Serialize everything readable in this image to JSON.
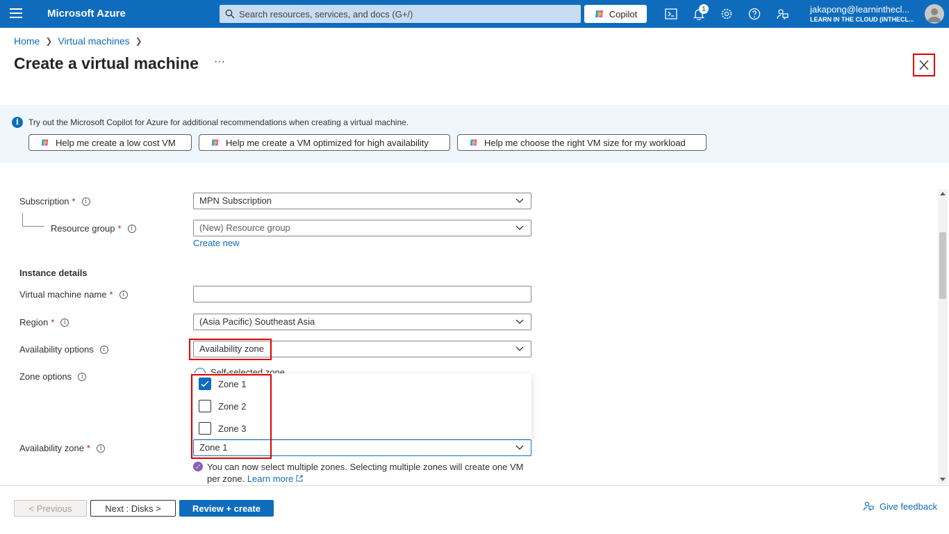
{
  "topbar": {
    "brand": "Microsoft Azure",
    "search_placeholder": "Search resources, services, and docs (G+/)",
    "copilot_label": "Copilot",
    "notification_count": "1",
    "account_email": "jakapong@learninthecl...",
    "account_tenant": "LEARN IN THE CLOUD (INTHECL..."
  },
  "breadcrumb": {
    "home": "Home",
    "virtual_machines": "Virtual machines"
  },
  "page": {
    "title": "Create a virtual machine",
    "more": "···"
  },
  "banner": {
    "message": "Try out the Microsoft Copilot for Azure for additional recommendations when creating a virtual machine.",
    "suggestions": [
      "Help me create a low cost VM",
      "Help me create a VM optimized for high availability",
      "Help me choose the right VM size for my workload"
    ]
  },
  "form": {
    "subscription": {
      "label": "Subscription",
      "value": "MPN Subscription"
    },
    "resource_group": {
      "label": "Resource group",
      "value": "(New) Resource group",
      "create_new": "Create new"
    },
    "instance_details": "Instance details",
    "vm_name": {
      "label": "Virtual machine name",
      "value": ""
    },
    "region": {
      "label": "Region",
      "value": "(Asia Pacific) Southeast Asia"
    },
    "availability_options": {
      "label": "Availability options",
      "value": "Availability zone"
    },
    "zone_options": {
      "label": "Zone options",
      "peek_text": "Self-selected zone"
    },
    "zone_list": [
      "Zone 1",
      "Zone 2",
      "Zone 3"
    ],
    "zone_checked": [
      true,
      false,
      false
    ],
    "availability_zone": {
      "label": "Availability zone",
      "value": "Zone 1"
    },
    "note": "You can now select multiple zones. Selecting multiple zones will create one VM per zone.",
    "learn_more": "Learn more",
    "required_mark": "*",
    "info_mark": "i"
  },
  "footer": {
    "previous": "< Previous",
    "next": "Next : Disks >",
    "review": "Review + create",
    "feedback": "Give feedback"
  },
  "colors": {
    "accent": "#0f6cbd",
    "highlight_box": "#e00000",
    "required": "#a4262c"
  }
}
